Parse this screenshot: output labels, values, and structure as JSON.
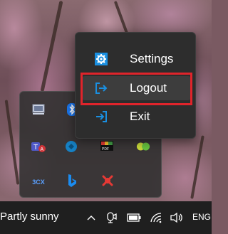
{
  "context_menu": {
    "items": [
      {
        "label": "Settings",
        "icon": "gear-icon"
      },
      {
        "label": "Logout",
        "icon": "logout-icon"
      },
      {
        "label": "Exit",
        "icon": "exit-icon"
      }
    ],
    "highlighted_item": "Logout",
    "highlight_color": "#e0242b",
    "accent_color": "#1a8fe0"
  },
  "tray_flyout": {
    "icons": [
      "display-icon",
      "bluetooth-icon",
      "teams-icon",
      "security-icon",
      "pdf-icon",
      "green-app-icon",
      "3cx-label",
      "bing-icon",
      "red-x-icon"
    ],
    "labels": {
      "cx": "3CX"
    }
  },
  "taskbar": {
    "weather": "Partly sunny",
    "language": "ENG",
    "icons": [
      "chevron-up-icon",
      "meet-now-icon",
      "battery-icon",
      "wifi-icon",
      "volume-icon"
    ]
  }
}
